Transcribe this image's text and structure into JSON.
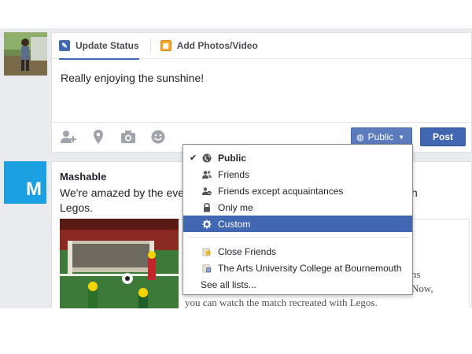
{
  "composer": {
    "tabs": [
      {
        "label": "Update Status",
        "icon": "pencil-icon",
        "active": true
      },
      {
        "label": "Add Photos/Video",
        "icon": "photo-icon",
        "active": false
      }
    ],
    "status_text": "Really enjoying the sunshine!",
    "tools": [
      "tag-friends-icon",
      "location-pin-icon",
      "camera-icon",
      "emoji-icon"
    ],
    "privacy_label": "Public",
    "post_label": "Post",
    "accent_color": "#4267b2"
  },
  "story": {
    "avatar_letter": "M",
    "author": "Mashable",
    "text_start": "We're amazed by the eve",
    "text_end": "h",
    "text_line2": "Legos.",
    "link_fragment_1": "ns",
    "link_fragment_2": "Now,",
    "link_fragment_3": "you can watch the match recreated with Legos."
  },
  "dropdown": {
    "items": [
      {
        "label": "Public",
        "icon": "globe-icon",
        "checked": true
      },
      {
        "label": "Friends",
        "icon": "friends-icon"
      },
      {
        "label": "Friends except acquaintances",
        "icon": "friends-except-icon"
      },
      {
        "label": "Only me",
        "icon": "lock-icon"
      },
      {
        "label": "Custom",
        "icon": "gear-icon",
        "highlighted": true
      },
      {
        "label": "Close Friends",
        "icon": "star-list-icon"
      },
      {
        "label": "The Arts University College at Bournemouth",
        "icon": "building-icon"
      },
      {
        "label": "See all lists..."
      }
    ],
    "highlight_color": "#4267b2"
  }
}
